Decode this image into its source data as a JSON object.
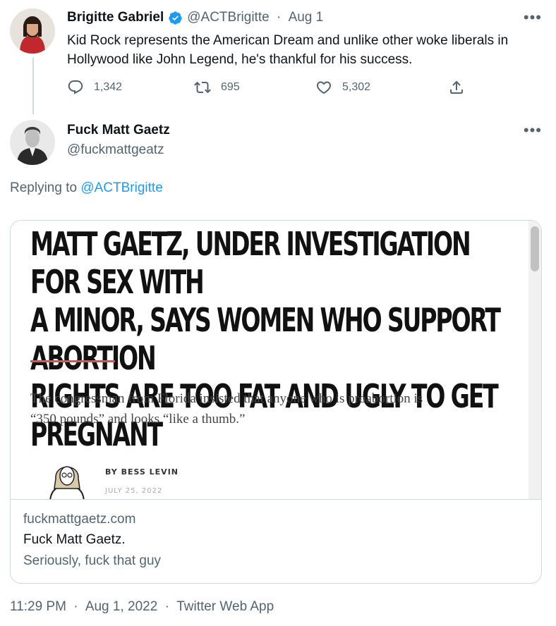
{
  "tweet1": {
    "display_name": "Brigitte Gabriel",
    "handle": "@ACTBrigitte",
    "separator": "·",
    "date": "Aug 1",
    "text": "Kid Rock represents the American Dream and unlike other woke liberals in Hollywood like John Legend, he's thankful for his success.",
    "stats": {
      "replies": "1,342",
      "retweets": "695",
      "likes": "5,302"
    }
  },
  "tweet2": {
    "display_name": "Fuck Matt Gaetz",
    "handle": "@fuckmattgeatz",
    "replying_prefix": "Replying to",
    "replying_handle": "@ACTBrigitte",
    "card": {
      "headline_lines": [
        "MATT GAETZ, UNDER INVESTIGATION FOR SEX WITH",
        "A MINOR, SAYS WOMEN WHO SUPPORT ABORTION",
        "RIGHTS ARE TOO FAT AND UGLY TO GET PREGNANT"
      ],
      "dek_lines": [
        "The congressman from Florida insisted that anyone who is proabortion is",
        "“350 pounds” and looks “like a thumb.”"
      ],
      "byline": "BY BESS LEVIN",
      "byline_date": "JULY 25, 2022",
      "domain": "fuckmattgaetz.com",
      "title": "Fuck Matt Gaetz.",
      "description": "Seriously, fuck that guy"
    },
    "footer": {
      "time": "11:29 PM",
      "separator": "·",
      "date": "Aug 1, 2022",
      "source": "Twitter Web App"
    }
  },
  "icons": {
    "more": "more-icon",
    "reply": "reply-icon",
    "retweet": "retweet-icon",
    "like": "heart-icon",
    "share": "share-icon",
    "verified": "verified-badge-icon"
  },
  "colors": {
    "accent": "#1d9bf0",
    "muted": "#536471",
    "text": "#0f1419",
    "border": "#cfd9de",
    "rule": "#d9534f"
  }
}
